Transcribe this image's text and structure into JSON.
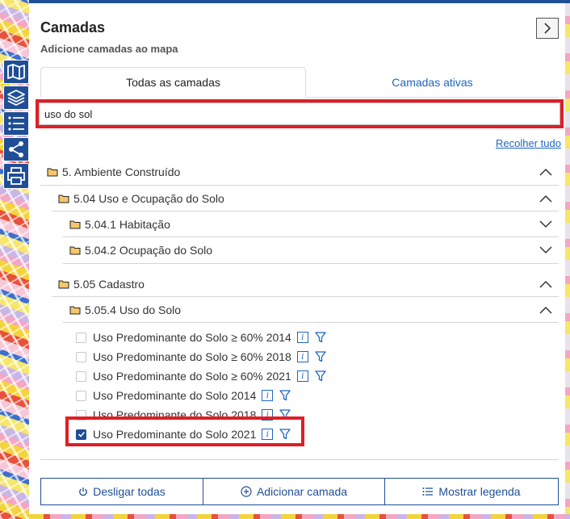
{
  "panel": {
    "title": "Camadas",
    "subtitle": "Adicione camadas ao mapa"
  },
  "tabs": [
    {
      "label": "Todas as camadas",
      "active": true
    },
    {
      "label": "Camadas ativas",
      "active": false
    }
  ],
  "search": {
    "value": "uso do sol"
  },
  "collapse_all": "Recolher tudo",
  "tree": {
    "group_1": {
      "label": "5. Ambiente Construído",
      "expanded": true
    },
    "sub_504": {
      "label": "5.04 Uso e Ocupação do Solo",
      "expanded": true
    },
    "sub_5041": {
      "label": "5.04.1 Habitação",
      "expanded": false
    },
    "sub_5042": {
      "label": "5.04.2 Ocupação do Solo",
      "expanded": false
    },
    "sub_505": {
      "label": "5.05 Cadastro",
      "expanded": true
    },
    "sub_5054": {
      "label": "5.05.4 Uso do Solo",
      "expanded": true
    }
  },
  "layers": [
    {
      "label": "Uso Predominante do Solo ≥ 60% 2014",
      "checked": false
    },
    {
      "label": "Uso Predominante do Solo ≥ 60% 2018",
      "checked": false
    },
    {
      "label": "Uso Predominante do Solo ≥ 60% 2021",
      "checked": false
    },
    {
      "label": "Uso Predominante do Solo 2014",
      "checked": false
    },
    {
      "label": "Uso Predominante do Solo 2018",
      "checked": false
    },
    {
      "label": "Uso Predominante do Solo 2021",
      "checked": true
    }
  ],
  "icons": {
    "info": "i"
  },
  "actions": {
    "disable_all": "Desligar todas",
    "add_layer": "Adicionar camada",
    "show_legend": "Mostrar legenda"
  },
  "colors": {
    "accent": "#1f4e96",
    "link": "#1f66c1",
    "highlight": "#e01e26"
  }
}
